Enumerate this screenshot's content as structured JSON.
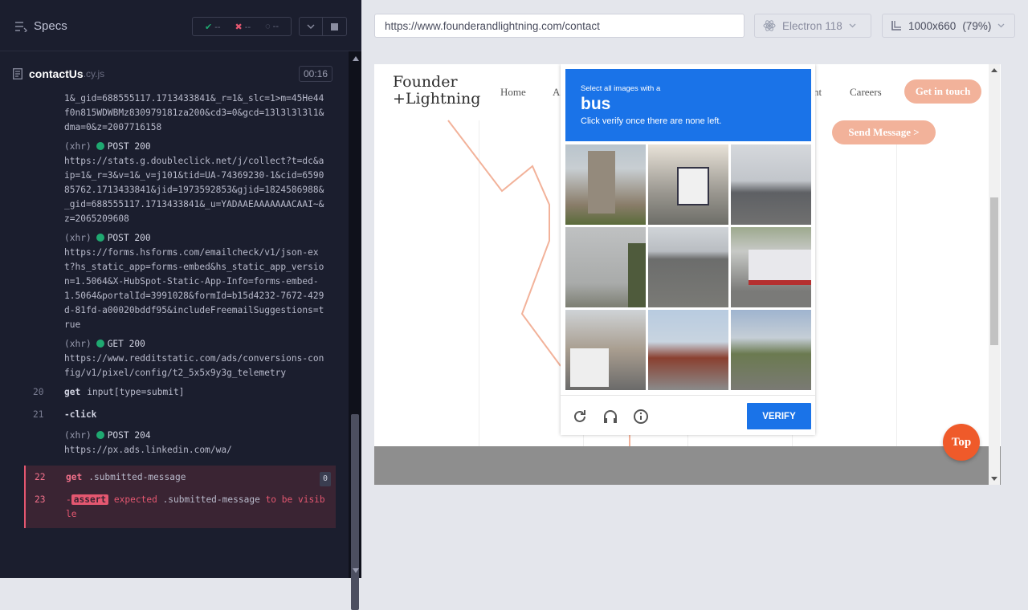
{
  "runner": {
    "specs_label": "Specs",
    "stats": {
      "passed": "--",
      "failed": "--",
      "pending": "--"
    },
    "file": {
      "name": "contactUs",
      "ext": ".cy.js",
      "time": "00:16"
    }
  },
  "log": [
    {
      "kind": "text",
      "text": "1&_gid=688555117.1713433841&_r=1&_slc=1>m=45He44f0n815WDWBMz830979181za200&cd3=0&gcd=13l3l3l3l1&dma=0&z=2007716158"
    },
    {
      "kind": "xhr",
      "tag": "(xhr)",
      "method": "POST 200",
      "url": "https://stats.g.doubleclick.net/j/collect?t=dc&aip=1&_r=3&v=1&_v=j101&tid=UA-74369230-1&cid=659085762.1713433841&jid=1973592853&gjid=1824586988&_gid=688555117.1713433841&_u=YADAAEAAAAAAACAAI~&z=2065209608"
    },
    {
      "kind": "xhr",
      "tag": "(xhr)",
      "method": "POST 200",
      "url": "https://forms.hsforms.com/emailcheck/v1/json-ext?hs_static_app=forms-embed&hs_static_app_version=1.5064&X-HubSpot-Static-App-Info=forms-embed-1.5064&portalId=3991028&formId=b15d4232-7672-429d-81fd-a00020bddf95&includeFreemailSuggestions=true"
    },
    {
      "kind": "xhr",
      "tag": "(xhr)",
      "method": "GET 200",
      "url": "https://www.redditstatic.com/ads/conversions-config/v1/pixel/config/t2_5x5x9y3g_telemetry"
    },
    {
      "kind": "cmd",
      "num": "20",
      "cmd": "get",
      "sel": "input[type=submit]"
    },
    {
      "kind": "cmd",
      "num": "21",
      "cmd": "-click",
      "sel": ""
    },
    {
      "kind": "xhr",
      "tag": "(xhr)",
      "method": "POST 204",
      "url": "https://px.ads.linkedin.com/wa/"
    },
    {
      "kind": "fail",
      "num": "22",
      "cmd": "get",
      "sel": ".submitted-message",
      "pill": "0"
    },
    {
      "kind": "assert",
      "num": "23",
      "cmd": "-",
      "badge": "assert",
      "msg": "expected",
      "sel": ".submitted-message",
      "rest": "to be visible"
    }
  ],
  "browser": {
    "url": "https://www.founderandlightning.com/contact",
    "name": "Electron 118",
    "viewport": "1000x660",
    "zoom": "(79%)"
  },
  "site": {
    "logo_line1": "Founder",
    "logo_line2": "+Lightning",
    "nav": {
      "home": "Home",
      "a": "A",
      "nt": "nt",
      "careers": "Careers"
    },
    "cta": "Get in touch",
    "send": "Send Message >",
    "top": "Top"
  },
  "captcha": {
    "small": "Select all images with a",
    "target": "bus",
    "instruction": "Click verify once there are none left.",
    "verify": "VERIFY",
    "icons": [
      "reload-icon",
      "headphones-icon",
      "info-icon"
    ]
  },
  "colors": {
    "accent": "#1a73e8",
    "brand": "#f2b29a",
    "fail": "#e45770",
    "top": "#ef5a2a"
  }
}
